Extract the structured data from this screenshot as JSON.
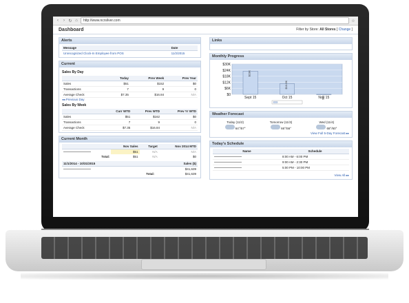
{
  "browser": {
    "url": "http://www.ncrsilver.com"
  },
  "dashboard": {
    "title": "Dashboard",
    "filter_label": "Filter by Store:",
    "filter_value": "All Stores",
    "change_label": "Change"
  },
  "alerts": {
    "title": "Alerts",
    "col_message": "Message",
    "col_date": "Date",
    "message": "Unrecognized Clock-In Employee from POS",
    "date": "11/2/2015"
  },
  "current": {
    "title": "Current",
    "by_day_title": "Sales By Day",
    "by_day_headers": [
      "Today",
      "Prev Week",
      "Prev Year"
    ],
    "by_day_rows": [
      {
        "label": "Sales",
        "c1": "$51",
        "c2": "$152",
        "c3": "$0"
      },
      {
        "label": "Transactions",
        "c1": "7",
        "c2": "9",
        "c3": "0"
      },
      {
        "label": "Average Check",
        "c1": "$7.35",
        "c2": "$16.84",
        "c3": "N/A"
      }
    ],
    "prev_day_link": "Previous Day",
    "by_week_title": "Sales By Week",
    "by_week_headers": [
      "Curr WTD",
      "Prev WTD",
      "Prev Yr WTD"
    ],
    "by_week_rows": [
      {
        "label": "Sales",
        "c1": "$51",
        "c2": "$162",
        "c3": "$0"
      },
      {
        "label": "Transactions",
        "c1": "7",
        "c2": "9",
        "c3": "0"
      },
      {
        "label": "Average Check",
        "c1": "$7.35",
        "c2": "$16.84",
        "c3": "N/A"
      }
    ]
  },
  "current_month": {
    "title": "Current Month",
    "headers": [
      "Nov Sales",
      "Target",
      "Nov 2014 MTD"
    ],
    "row1": {
      "c1": "$51",
      "c2": "N/A",
      "c3": "N/A"
    },
    "total_label": "Total:",
    "total": {
      "c1": "$51",
      "c2": "N/A",
      "c3": "$0"
    },
    "range_label": "11/1/2014 - 10/31/2015",
    "sales_label": "Sales ($)",
    "sales_value": "$41,639",
    "total2": "$41,639"
  },
  "links": {
    "title": "Links"
  },
  "monthly": {
    "title": "Monthly Progress"
  },
  "chart_data": {
    "type": "bar",
    "categories": [
      "Sept 15",
      "Oct 15",
      "Nov 15"
    ],
    "values": [
      23000,
      10600,
      51
    ],
    "value_labels": [
      "$23K",
      "$10.6K",
      "$51"
    ],
    "yticks": [
      "$30K",
      "$24K",
      "$18K",
      "$12K",
      "$6K",
      "$0"
    ],
    "ylim": [
      0,
      30000
    ],
    "colors": {
      "bar": "#c7d8f0",
      "plot": "#c9d9ef"
    }
  },
  "weather": {
    "title": "Weather Forecast",
    "days": [
      {
        "label": "Today (11/2)",
        "hi": "64°",
        "lo": "57°"
      },
      {
        "label": "Tomorrow (11/3)",
        "hi": "66°",
        "lo": "56°"
      },
      {
        "label": "Wed (11/4)",
        "hi": "68°",
        "lo": "60°"
      }
    ],
    "forecast_link": "View Full 5-Day Forecast"
  },
  "schedule": {
    "title": "Today's Schedule",
    "col_name": "Name",
    "col_schedule": "Schedule",
    "rows": [
      "8:00 AM - 6:00 PM",
      "9:00 AM - 2:30 PM",
      "5:00 PM - 10:00 PM"
    ],
    "view_all": "View All"
  }
}
